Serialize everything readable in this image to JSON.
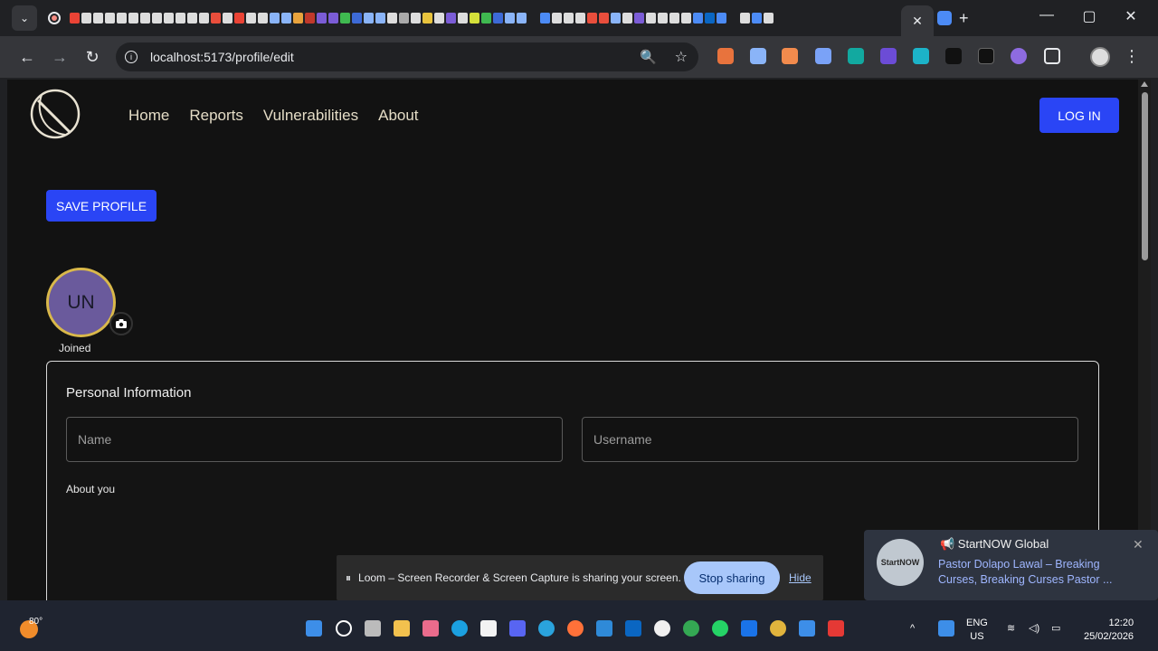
{
  "browser": {
    "url": "localhost:5173/profile/edit",
    "active_tab_close": "✕",
    "new_tab": "+"
  },
  "nav": {
    "links": [
      "Home",
      "Reports",
      "Vulnerabilities",
      "About"
    ],
    "login_label": "LOG IN"
  },
  "profile": {
    "save_label": "SAVE PROFILE",
    "avatar_initials": "UN",
    "joined_label": "Joined",
    "section_title": "Personal Information",
    "name_placeholder": "Name",
    "username_placeholder": "Username",
    "about_label": "About you"
  },
  "loom": {
    "message": "Loom – Screen Recorder & Screen Capture is sharing your screen.",
    "stop_label": "Stop sharing",
    "hide_label": "Hide"
  },
  "notification": {
    "title": "📢 StartNOW Global",
    "body": "Pastor Dolapo Lawal – Breaking Curses, Breaking Curses Pastor ...",
    "icon_text": "StartNOW"
  },
  "taskbar": {
    "temperature": "80°",
    "language": "ENG",
    "region": "US",
    "time": "12:20",
    "date": "25/02/2026"
  },
  "colors": {
    "accent": "#2a45f5",
    "avatar_bg": "#6a5a9c",
    "avatar_ring": "#d9b84a",
    "nav_text": "#e4dcc6"
  }
}
